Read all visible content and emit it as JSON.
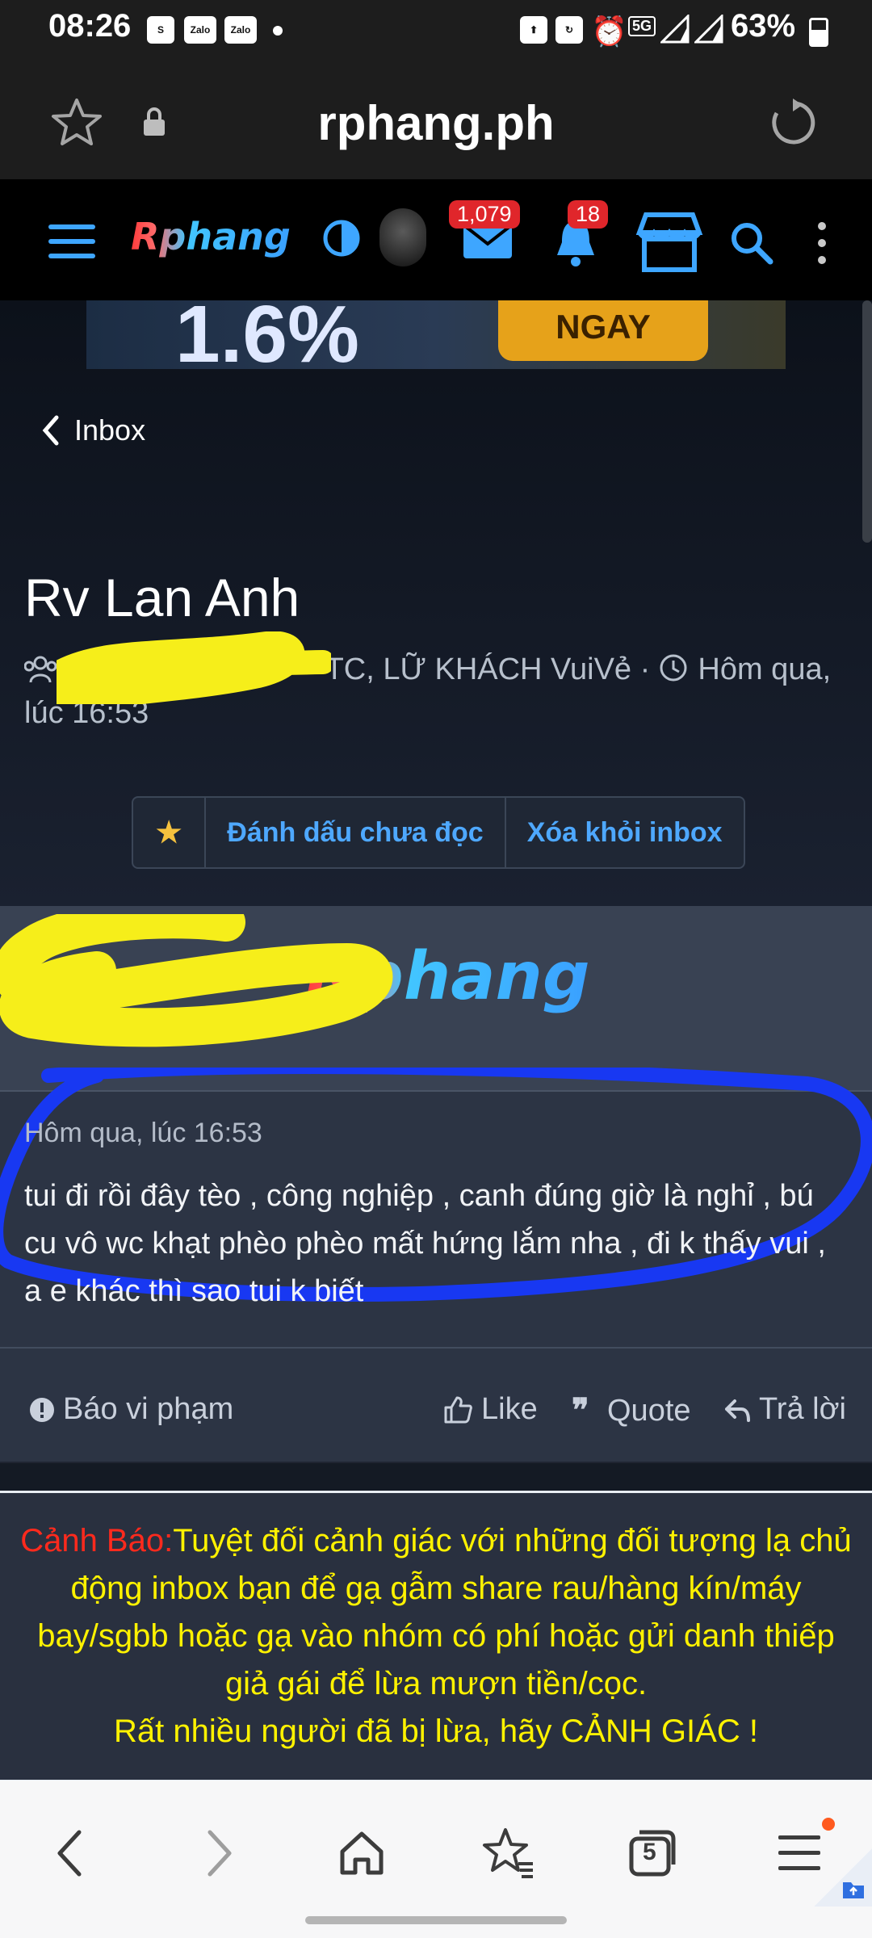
{
  "status_bar": {
    "time": "08:26",
    "battery": "63%",
    "notification_icons": [
      "shopee-icon",
      "zalo-icon",
      "zalo-icon",
      "dot-icon"
    ],
    "system_icons": [
      "upload-icon",
      "data-saver-icon",
      "alarm-icon",
      "5g-icon",
      "signal-icon",
      "signal-icon",
      "battery-icon"
    ],
    "zalo_label": "Zalo",
    "network_label": "5G"
  },
  "browser": {
    "url": "rphang.ph"
  },
  "site_nav": {
    "logo": "Rphang",
    "inbox_count": "1,079",
    "alerts_count": "18"
  },
  "banner": {
    "percent": "1.6%",
    "button": "NGAY"
  },
  "header": {
    "back_label": "Inbox",
    "title": "Rv Lan Anh",
    "participants": "TC, LỮ KHÁCH VuiVẻ ·",
    "timestamp": "Hôm qua, lúc 16:53",
    "actions": {
      "star": "★",
      "mark_unread": "Đánh dấu chưa đọc",
      "remove": "Xóa khỏi inbox"
    }
  },
  "message": {
    "logo": "Rphang",
    "time": "Hôm qua, lúc 16:53",
    "body": "tui đi rồi đây tèo , công nghiệp , canh đúng giờ là nghỉ , bú cu vô wc khạt phèo phèo mất hứng lắm nha , đi k thấy vui , a e khác thì sao tui k biết",
    "report": "Báo vi phạm",
    "like": "Like",
    "quote": "Quote",
    "reply": "Trả lời"
  },
  "warning": {
    "title": "Cảnh Báo:",
    "text": "Tuyệt đối cảnh giác với những đối tượng lạ chủ động inbox bạn để gạ gẫm share rau/hàng kín/máy bay/sgbb hoặc gạ vào nhóm có phí hoặc gửi danh thiếp giả gái để lừa mượn tiền/cọc.",
    "footer": "Rất nhiều người đã bị lừa, hãy CẢNH GIÁC !"
  },
  "bottom_nav": {
    "tabs_count": "5"
  },
  "colors": {
    "accent_blue": "#4ea8ff",
    "warning_yellow": "#fff200",
    "warning_red": "#ff2a1d",
    "badge_red": "#e0262b"
  }
}
